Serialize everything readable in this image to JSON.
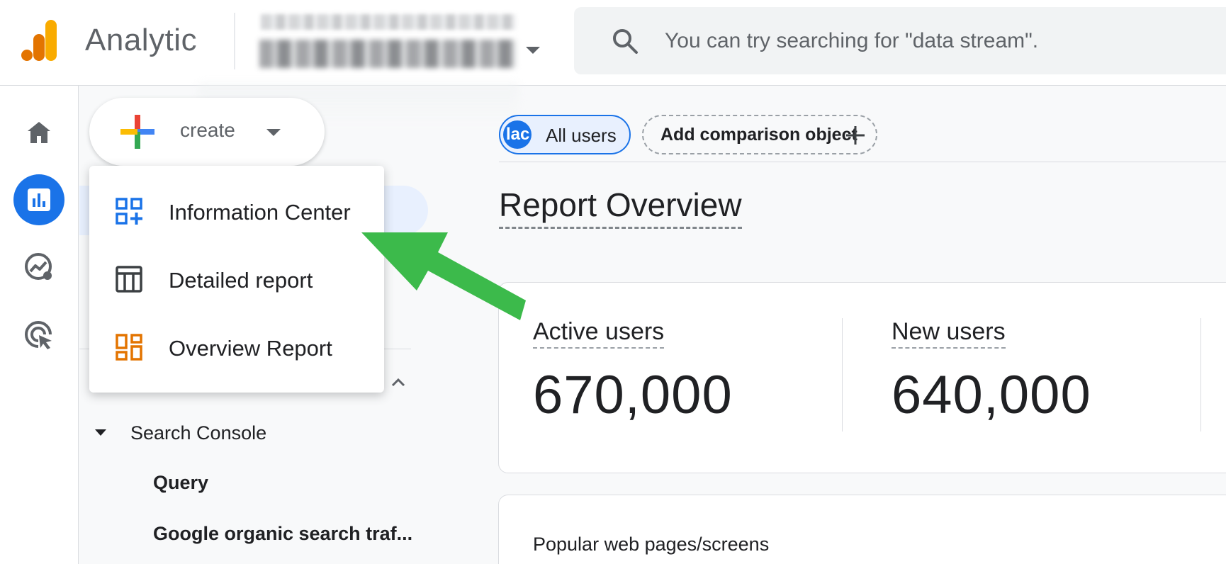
{
  "header": {
    "brand": "Analytic",
    "search_placeholder": "You can try searching for \"data stream\"."
  },
  "rail": {
    "items": [
      {
        "icon": "home-icon",
        "label": "Home"
      },
      {
        "icon": "reports-icon",
        "label": "Reports",
        "active": true
      },
      {
        "icon": "explore-icon",
        "label": "Explore"
      },
      {
        "icon": "advertising-icon",
        "label": "Advertising"
      }
    ]
  },
  "create": {
    "label": "create"
  },
  "menu": {
    "items": [
      {
        "label": "Information Center",
        "icon": "library-add-icon",
        "color": "#1a73e8"
      },
      {
        "label": "Detailed report",
        "icon": "table-icon",
        "color": "#3c4043"
      },
      {
        "label": "Overview Report",
        "icon": "dashboard-icon",
        "color": "#e37400"
      }
    ]
  },
  "sidenav": {
    "group_label": "Search Console",
    "sub_items": [
      "Query",
      "Google organic search traf..."
    ]
  },
  "comparison": {
    "avatar_text": "lac",
    "all_users": "All users",
    "add_label": "Add comparison object"
  },
  "main": {
    "title": "Report Overview",
    "metrics": [
      {
        "label": "Active users",
        "value": "670,000"
      },
      {
        "label": "New users",
        "value": "640,000"
      }
    ],
    "card2_title": "Popular web pages/screens"
  },
  "colors": {
    "accent": "#1a73e8",
    "arrow": "#3cba4b",
    "logo_orange_dark": "#e37400",
    "logo_orange_light": "#f9ab00"
  }
}
